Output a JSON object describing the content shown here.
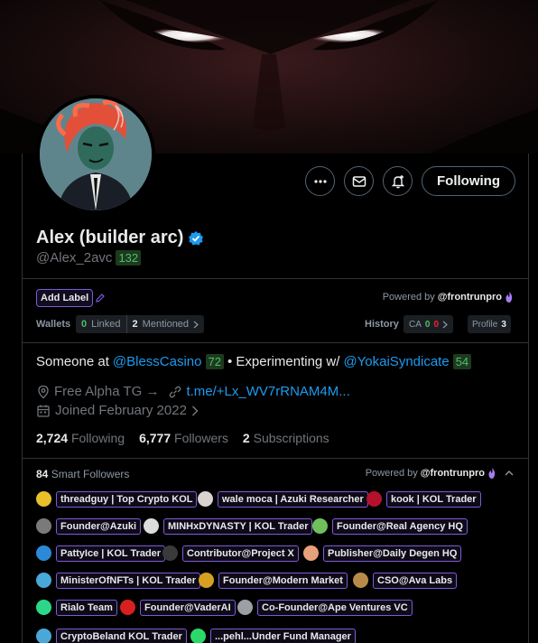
{
  "header": {
    "name": "Alex (builder arc)",
    "handle": "@Alex_2avc",
    "handle_score": "132",
    "following_button": "Following"
  },
  "icons": {
    "more": "more-icon",
    "message": "mail-icon",
    "notify": "bell-plus-icon",
    "verified": "verified-badge-icon"
  },
  "tools": {
    "add_label": "Add Label",
    "powered_by": "Powered by",
    "powered_brand": "@frontrunpro",
    "wallets_label": "Wallets",
    "linked_count": "0",
    "linked_label": "Linked",
    "mentioned_count": "2",
    "mentioned_label": "Mentioned",
    "history_label": "History",
    "ca_label": "CA",
    "ca_green": "0",
    "ca_red": "0",
    "profile_label": "Profile",
    "profile_count": "3"
  },
  "bio": {
    "part1": "Someone at",
    "mention1": "@BlessCasino",
    "score1": "72",
    "part2": "• Experimenting w/",
    "mention2": "@YokaiSyndicate",
    "score2": "54"
  },
  "meta": {
    "location": "Free Alpha TG →",
    "url": "t.me/+Lx_WV7rRNAM4M...",
    "joined": "Joined February 2022"
  },
  "counts": {
    "following_num": "2,724",
    "following_label": "Following",
    "followers_num": "6,777",
    "followers_label": "Followers",
    "subs_num": "2",
    "subs_label": "Subscriptions"
  },
  "smart": {
    "count": "84",
    "label": "Smart Followers",
    "powered_by": "Powered by",
    "powered_brand": "@frontrunpro"
  },
  "followers": [
    {
      "label": "threadguy | Top Crypto KOL",
      "color": "#e8c02a"
    },
    {
      "label": "wale moca | Azuki Researcher",
      "color": "#d9d2cf"
    },
    {
      "label": "kook | KOL Trader",
      "color": "#b3122a"
    },
    {
      "label": "Founder@Azuki",
      "color": "#7a7a7a"
    },
    {
      "label": "MINHxDYNASTY | KOL Trader",
      "color": "#dcdcdc"
    },
    {
      "label": "Founder@Real Agency HQ",
      "color": "#6fbf5a"
    },
    {
      "label": "PattyIce | KOL Trader",
      "color": "#2b8ad8"
    },
    {
      "label": "Contributor@Project X",
      "color": "#3a3a3a"
    },
    {
      "label": "Publisher@Daily Degen HQ",
      "color": "#e8a07a"
    },
    {
      "label": "MinisterOfNFTs | KOL Trader",
      "color": "#4aa8d8"
    },
    {
      "label": "Founder@Modern Market",
      "color": "#d8a020"
    },
    {
      "label": "CSO@Ava Labs",
      "color": "#b88a4a"
    },
    {
      "label": "Rialo Team",
      "color": "#2bd88a"
    },
    {
      "label": "Founder@VaderAI",
      "color": "#d82020"
    },
    {
      "label": "Co-Founder@Ape Ventures VC",
      "color": "#9aa0a6"
    },
    {
      "label": "CryptoBeland KOL Trader",
      "color": "#4aa8d8"
    },
    {
      "label": "...pehl...Under Fund Manager",
      "color": "#2bd86a"
    }
  ],
  "colors": {
    "accent_purple": "#7c5cd6",
    "link_blue": "#1d9bf0",
    "score_green": "#4bbf6b"
  }
}
